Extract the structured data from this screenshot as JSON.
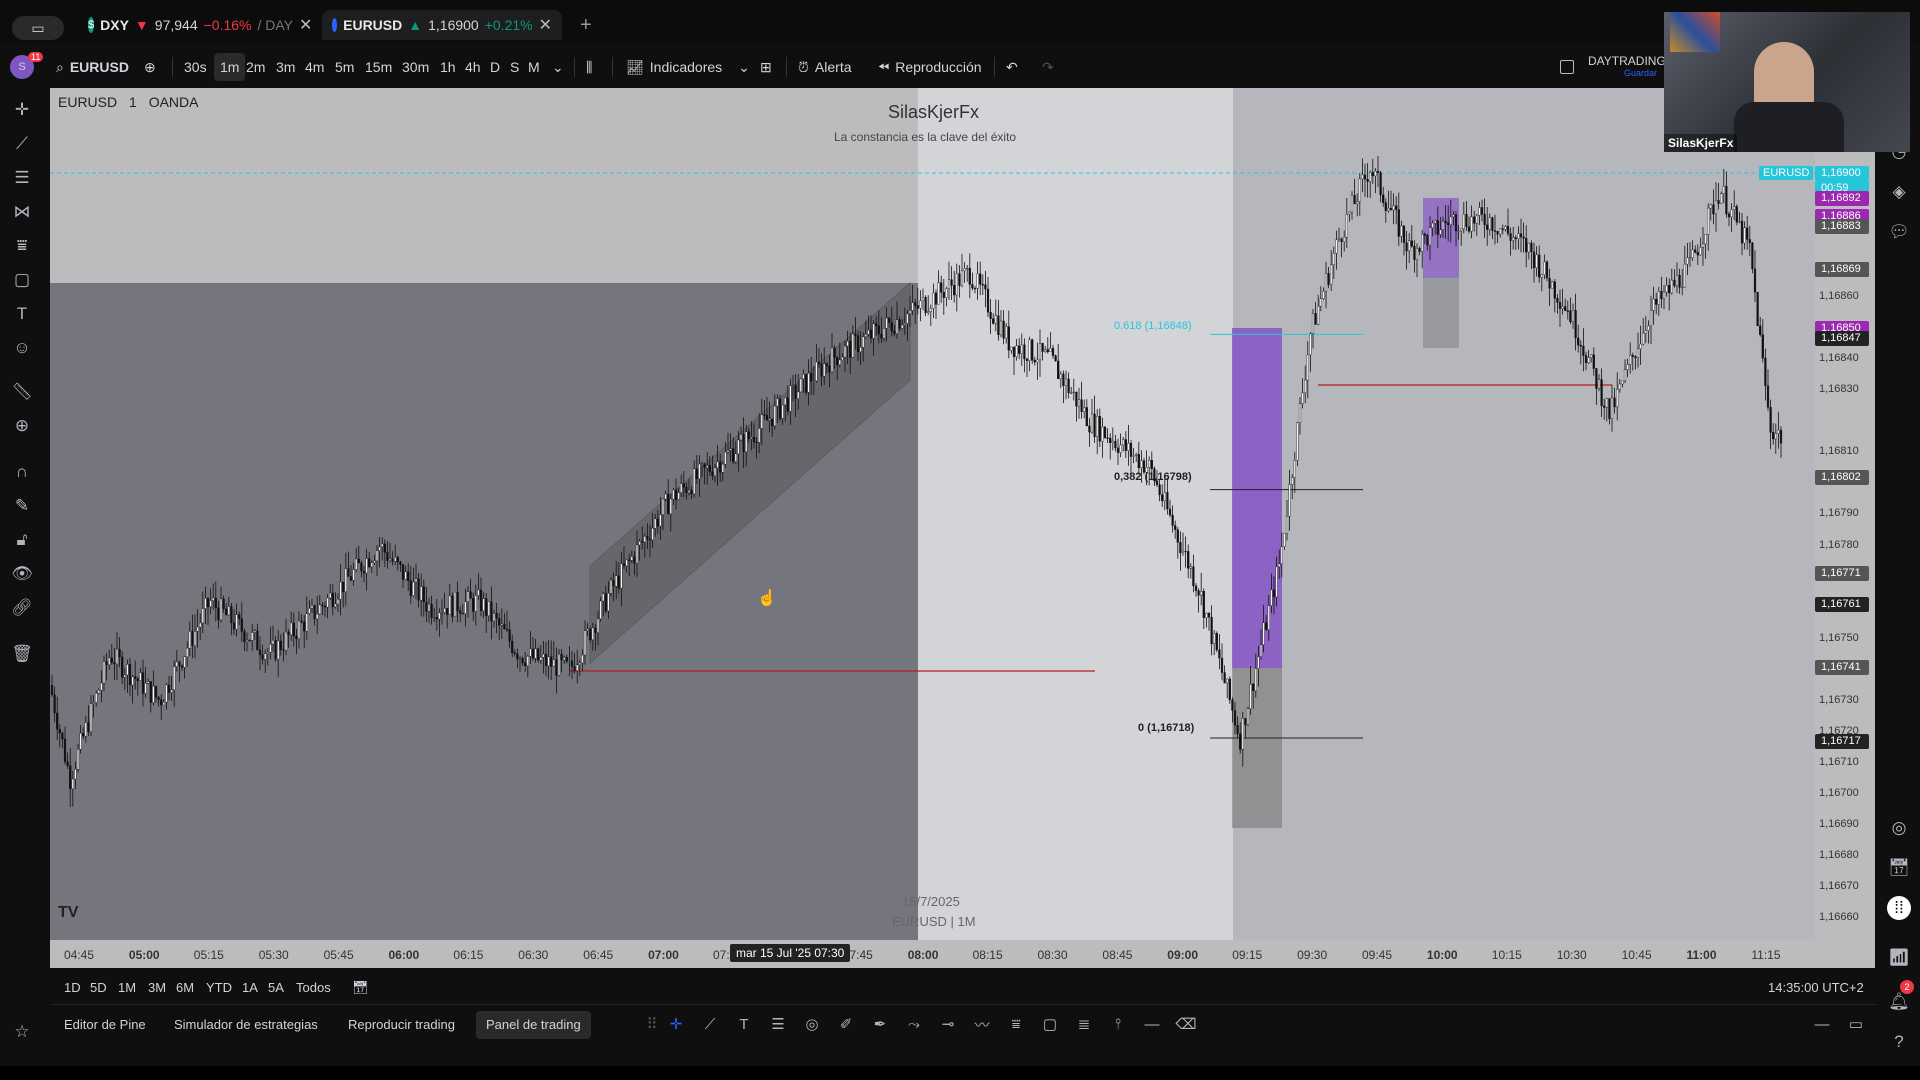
{
  "tabs": [
    {
      "symbol": "DXY",
      "arrow": "▼",
      "price": "97,944",
      "change": "−0.16%",
      "extra": "/ DAY",
      "direction": "down"
    },
    {
      "symbol": "EURUSD",
      "arrow": "▲",
      "price": "1,16900",
      "change": "+0.21%",
      "extra": "",
      "direction": "up"
    }
  ],
  "toolbar": {
    "symbol": "EURUSD",
    "badge": "11",
    "timeframes": [
      "30s",
      "1m",
      "2m",
      "3m",
      "4m",
      "5m",
      "15m",
      "30m",
      "1h",
      "4h",
      "D",
      "S",
      "M"
    ],
    "active_timeframe": "1m",
    "indicators": "Indicadores",
    "alert": "Alerta",
    "replay": "Reproducción",
    "layout_name": "DAYTRADING",
    "save": "Guardar"
  },
  "chart": {
    "legend_symbol": "EURUSD",
    "legend_interval": "1",
    "legend_source": "OANDA",
    "watermark_title": "SilasKjerFx",
    "watermark_subtitle": "La constancia es la clave del éxito",
    "bottom_date": "15/7/2025",
    "bottom_symbol": "EURUSD | 1M",
    "fib": [
      {
        "label": "0.618 (1,16848)",
        "value": 1.16848
      },
      {
        "label": "0,382 (1,16798)",
        "value": 1.16798
      },
      {
        "label": "0 (1,16718)",
        "value": 1.16718
      }
    ],
    "crosshair_date": "mar 15 Jul '25   07:30"
  },
  "price_axis": {
    "labels": [
      "1,16860",
      "1,16840",
      "1,16830",
      "1,16810",
      "1,16790",
      "1,16780",
      "1,16750",
      "1,16730",
      "1,16720",
      "1,16710",
      "1,16700",
      "1,16690",
      "1,16680",
      "1,16670",
      "1,16660"
    ],
    "tags": [
      {
        "text": "1,16900",
        "sub": "00:59",
        "color": "#26c6da",
        "value": 1.169
      },
      {
        "text": "1,16892",
        "color": "#9c27b0",
        "value": 1.16892
      },
      {
        "text": "1,16886",
        "color": "#9c27b0",
        "value": 1.16886
      },
      {
        "text": "1,16883",
        "color": "#555",
        "value": 1.16883
      },
      {
        "text": "1,16869",
        "color": "#222",
        "value": 1.16869
      },
      {
        "text": "1,16869",
        "color": "#555",
        "value": 1.16869
      },
      {
        "text": "1,16850",
        "color": "#9c27b0",
        "value": 1.1685
      },
      {
        "text": "1,16847",
        "color": "#222",
        "value": 1.16847
      },
      {
        "text": "1,16802",
        "color": "#555",
        "value": 1.16802
      },
      {
        "text": "1,16771",
        "color": "#555",
        "value": 1.16771
      },
      {
        "text": "1,16761",
        "color": "#222",
        "value": 1.16761
      },
      {
        "text": "1,16741",
        "color": "#555",
        "value": 1.16741
      },
      {
        "text": "1,16717",
        "color": "#222",
        "value": 1.16717
      }
    ],
    "eurusd_tag": "EURUSD"
  },
  "time_axis": {
    "labels": [
      "04:45",
      "05:00",
      "05:15",
      "05:30",
      "05:45",
      "06:00",
      "06:15",
      "06:30",
      "06:45",
      "07:00",
      "07:15",
      "07:30",
      "07:45",
      "08:00",
      "08:15",
      "08:30",
      "08:45",
      "09:00",
      "09:15",
      "09:30",
      "09:45",
      "10:00",
      "10:15",
      "10:30",
      "10:45",
      "11:00",
      "11:15"
    ],
    "bold": [
      "05:00",
      "06:00",
      "07:00",
      "08:00",
      "09:00",
      "10:00",
      "11:00"
    ]
  },
  "range_bar": {
    "ranges": [
      "1D",
      "5D",
      "1M",
      "3M",
      "6M",
      "YTD",
      "1A",
      "5A",
      "Todos"
    ],
    "clock": "14:35:00 UTC+2"
  },
  "bottom_panel": {
    "tabs": [
      "Editor de Pine",
      "Simulador de estrategias",
      "Reproducir trading",
      "Panel de trading"
    ],
    "active": "Panel de trading"
  },
  "webcam": {
    "name": "SilasKjerFx"
  },
  "notifications": "2",
  "colors": {
    "up": "#089981",
    "down": "#f23645",
    "fib_line": "#26c6da",
    "purple": "#9c27b0",
    "red_line": "#b71c1c"
  }
}
